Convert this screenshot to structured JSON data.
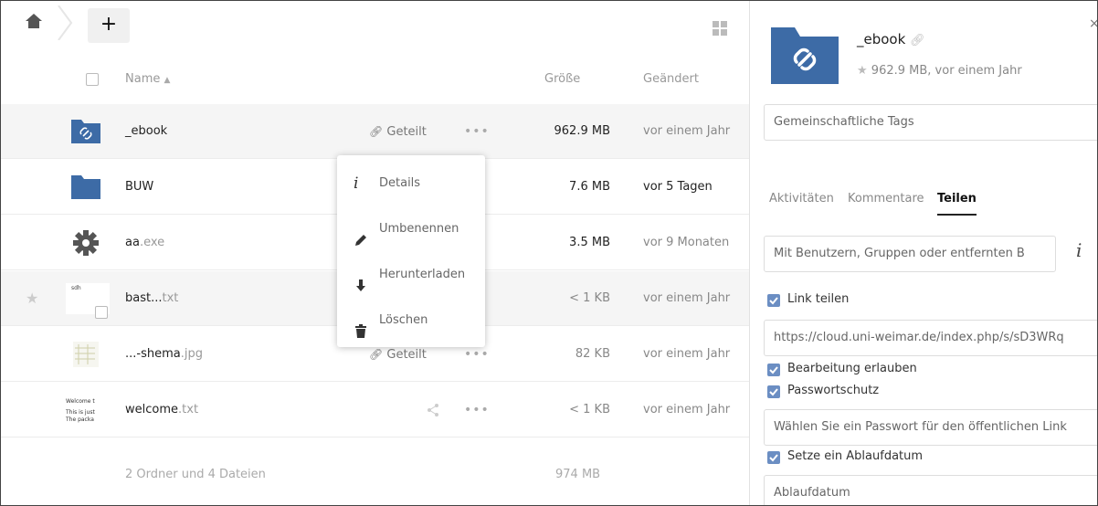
{
  "toolbar": {
    "add_label": "+"
  },
  "list": {
    "header": {
      "name": "Name",
      "size": "Größe",
      "modified": "Geändert"
    },
    "rows": [
      {
        "name": "_ebook",
        "ext": "",
        "size": "962.9 MB",
        "modified": "vor einem Jahr",
        "share": "Geteilt",
        "more": "•••"
      },
      {
        "name": "BUW",
        "ext": "",
        "size": "7.6 MB",
        "modified": "vor 5 Tagen"
      },
      {
        "name": "aa",
        "ext": ".exe",
        "size": "3.5 MB",
        "modified": "vor 9 Monaten"
      },
      {
        "name": "bast...",
        "ext": "txt",
        "size": "< 1 KB",
        "modified": "vor einem Jahr",
        "thumb_text": "sdh"
      },
      {
        "name": "...-shema",
        "ext": ".jpg",
        "size": "82 KB",
        "modified": "vor einem Jahr",
        "share": "Geteilt",
        "more": "•••"
      },
      {
        "name": "welcome",
        "ext": ".txt",
        "size": "< 1 KB",
        "modified": "vor einem Jahr",
        "more": "•••",
        "thumb_lines": [
          "Welcome t",
          "This is just",
          "The packa"
        ]
      }
    ],
    "summary": "2 Ordner und 4 Dateien",
    "summary_size": "974 MB"
  },
  "context_menu": {
    "items": [
      {
        "label": "Details",
        "icon": "info-icon"
      },
      {
        "label": "Umbenennen",
        "icon": "pencil-icon"
      },
      {
        "label": "Herunterladen",
        "icon": "download-icon"
      },
      {
        "label": "Löschen",
        "icon": "trash-icon"
      }
    ]
  },
  "sidebar": {
    "title": "_ebook",
    "meta": "962.9 MB, vor einem Jahr",
    "close": "×",
    "tags_placeholder": "Gemeinschaftliche Tags",
    "tabs": [
      "Aktivitäten",
      "Kommentare",
      "Teilen"
    ],
    "share_input": "Mit Benutzern, Gruppen oder entfernten B",
    "info_glyph": "i",
    "link_share_label": "Link teilen",
    "link_url": "https://cloud.uni-weimar.de/index.php/s/sD3WRq",
    "allow_edit_label": "Bearbeitung erlauben",
    "password_label": "Passwortschutz",
    "password_placeholder": "Wählen Sie ein Passwort für den öffentlichen Link",
    "expire_label": "Setze ein Ablaufdatum",
    "expire_placeholder": "Ablaufdatum"
  },
  "colors": {
    "folder": "#3d6ba6",
    "checkbox": "#6b8ec3",
    "menu_text": "#666666"
  }
}
